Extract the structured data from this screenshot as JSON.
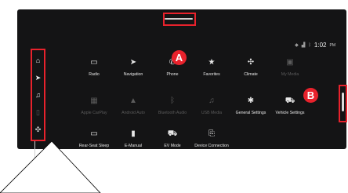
{
  "status": {
    "time": "1:02",
    "ampm": "PM"
  },
  "callouts": {
    "a": "A",
    "b": "B"
  },
  "apps": [
    {
      "label": "Radio",
      "icon": "▭",
      "enabled": true
    },
    {
      "label": "Navigation",
      "icon": "➤",
      "enabled": true
    },
    {
      "label": "Phone",
      "icon": "✆",
      "enabled": true
    },
    {
      "label": "Favorites",
      "icon": "★",
      "enabled": true
    },
    {
      "label": "Climate",
      "icon": "✣",
      "enabled": true
    },
    {
      "label": "My Media",
      "icon": "▣",
      "enabled": false
    },
    {
      "label": "Apple CarPlay",
      "icon": "▦",
      "enabled": false
    },
    {
      "label": "Android Auto",
      "icon": "▲",
      "enabled": false
    },
    {
      "label": "Bluetooth Audio",
      "icon": "ᛒ",
      "enabled": false
    },
    {
      "label": "USB Media",
      "icon": "♫",
      "enabled": false
    },
    {
      "label": "General Settings",
      "icon": "✱",
      "enabled": true
    },
    {
      "label": "Vehicle Settings",
      "icon": "⛟",
      "enabled": true
    },
    {
      "label": "Rear-Seat Sleep",
      "icon": "▭",
      "enabled": true
    },
    {
      "label": "E-Manual",
      "icon": "▮",
      "enabled": true
    },
    {
      "label": "EV Mode",
      "icon": "⛟",
      "enabled": true
    },
    {
      "label": "Device Connection",
      "icon": "⎘",
      "enabled": true
    }
  ],
  "left_bar": [
    {
      "icon": "home-icon",
      "glyph": "⌂",
      "enabled": true
    },
    {
      "icon": "navigation-icon",
      "glyph": "➤",
      "enabled": true
    },
    {
      "icon": "music-icon",
      "glyph": "♫",
      "enabled": true
    },
    {
      "icon": "phone-icon",
      "glyph": "▯",
      "enabled": false
    },
    {
      "icon": "fan-icon",
      "glyph": "✣",
      "enabled": true
    }
  ]
}
